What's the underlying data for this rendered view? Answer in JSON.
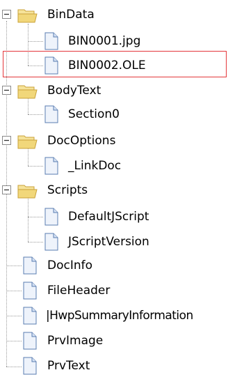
{
  "tree": {
    "nodes": [
      {
        "id": "bindata",
        "label": "BinData",
        "type": "folder",
        "expanded": true
      },
      {
        "id": "bin0001",
        "label": "BIN0001.jpg",
        "type": "file"
      },
      {
        "id": "bin0002",
        "label": "BIN0002.OLE",
        "type": "file",
        "highlighted": true
      },
      {
        "id": "bodytext",
        "label": "BodyText",
        "type": "folder",
        "expanded": true
      },
      {
        "id": "section0",
        "label": "Section0",
        "type": "file"
      },
      {
        "id": "docoptions",
        "label": "DocOptions",
        "type": "folder",
        "expanded": true
      },
      {
        "id": "linkdoc",
        "label": "_LinkDoc",
        "type": "file"
      },
      {
        "id": "scripts",
        "label": "Scripts",
        "type": "folder",
        "expanded": true
      },
      {
        "id": "defaultjscript",
        "label": "DefaultJScript",
        "type": "file"
      },
      {
        "id": "jscriptversion",
        "label": "JScriptVersion",
        "type": "file"
      },
      {
        "id": "docinfo",
        "label": "DocInfo",
        "type": "file"
      },
      {
        "id": "fileheader",
        "label": "FileHeader",
        "type": "file"
      },
      {
        "id": "hwpsummary",
        "label": "|HwpSummaryInformation",
        "type": "file"
      },
      {
        "id": "prvimage",
        "label": "PrvImage",
        "type": "file"
      },
      {
        "id": "prvtext",
        "label": "PrvText",
        "type": "file"
      }
    ]
  },
  "icons": {
    "folder": "open-folder-icon",
    "file": "document-icon",
    "expander": "minus-expander-icon"
  },
  "colors": {
    "folder_body": "#f1d77a",
    "folder_edge": "#c9a23a",
    "file_fill": "#eef3fb",
    "file_edge": "#5a7cb0",
    "tree_line": "#9a9a9a",
    "highlight": "#e4363a"
  }
}
